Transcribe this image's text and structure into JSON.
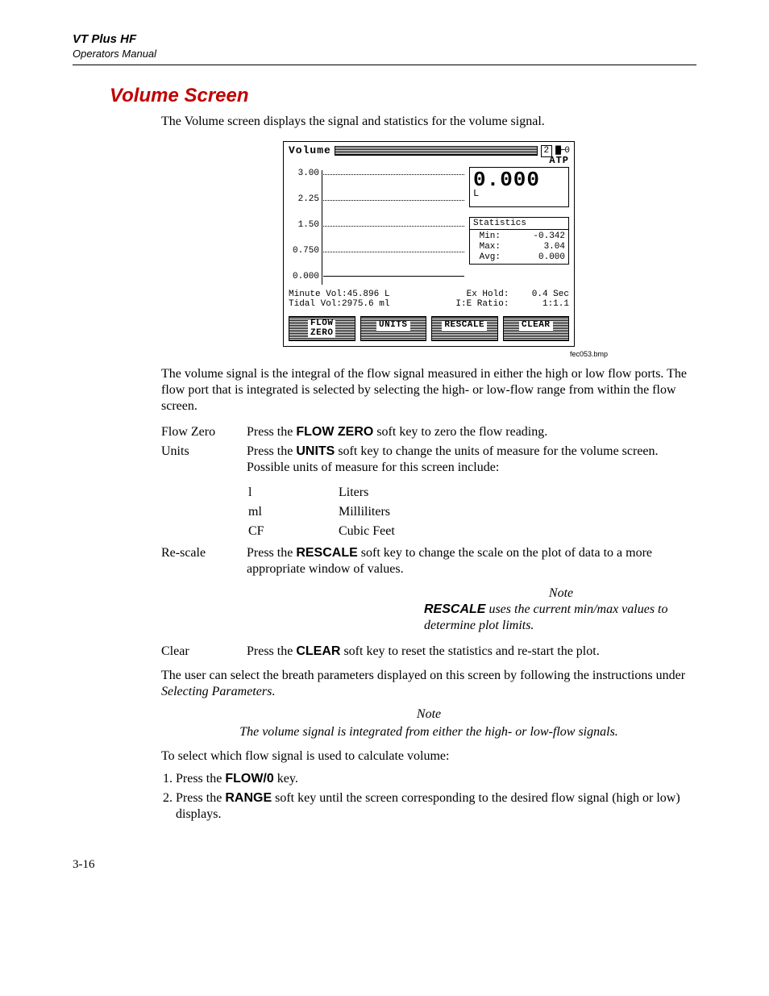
{
  "header": {
    "product": "VT Plus HF",
    "subtitle": "Operators Manual"
  },
  "section": {
    "title": "Volume Screen"
  },
  "intro": "The Volume screen displays the signal and statistics for the volume signal.",
  "figure": {
    "caption": "fec053.bmp",
    "title": "Volume",
    "top_badge": "2",
    "top_icons": "▇⊢0",
    "mode": "ATP",
    "readout": {
      "value": "0.000",
      "unit": "L"
    },
    "y_ticks": [
      "3.00",
      "2.25",
      "1.50",
      "0.750",
      "0.000"
    ],
    "stats": {
      "label": "Statistics",
      "rows": [
        {
          "k": "Min:",
          "v": "-0.342"
        },
        {
          "k": "Max:",
          "v": " 3.04"
        },
        {
          "k": "Avg:",
          "v": " 0.000"
        }
      ]
    },
    "params": {
      "r1c1": "Minute Vol:45.896 L",
      "r1c2": "Ex Hold:",
      "r1c3": "0.4 Sec",
      "r2c1": " Tidal Vol:2975.6 ml",
      "r2c2": "I:E Ratio:",
      "r2c3": "1:1.1"
    },
    "softkeys": [
      "FLOW\nZERO",
      "UNITS",
      "RESCALE",
      "CLEAR"
    ]
  },
  "after_fig": "The volume signal is the integral of the flow signal measured in either the high or low flow ports. The flow port that is integrated is selected by selecting the high- or low-flow range from within the flow screen.",
  "defs": {
    "flowzero": {
      "term": "Flow Zero",
      "pre": "Press the ",
      "key": "FLOW ZERO",
      "post": " soft key to zero the flow reading."
    },
    "units": {
      "term": "Units",
      "pre": "Press the ",
      "key": "UNITS",
      "post": " soft key to change the units of measure for the volume screen. Possible units of measure for this screen include:",
      "table": [
        {
          "sym": "l",
          "name": "Liters"
        },
        {
          "sym": "ml",
          "name": "Milliliters"
        },
        {
          "sym": "CF",
          "name": "Cubic Feet"
        }
      ]
    },
    "rescale": {
      "term": "Re-scale",
      "pre": "Press the ",
      "key": "RESCALE",
      "post": " soft key to change the scale on the plot of data to a more appropriate window of values."
    },
    "clear": {
      "term": "Clear",
      "pre": "Press the ",
      "key": "CLEAR",
      "post": " soft key to reset the statistics and re-start the plot."
    }
  },
  "note1": {
    "label": "Note",
    "key": "RESCALE",
    "body": " uses the current min/max values to determine plot limits."
  },
  "para2a": "The user can select the breath parameters displayed on this screen by following the instructions under ",
  "para2b": "Selecting Parameters",
  "para2c": ".",
  "note2": {
    "label": "Note",
    "body": "The volume signal is integrated from either the high- or low-flow signals."
  },
  "select_intro": "To select which flow signal is used to calculate volume:",
  "steps": {
    "s1_pre": "Press the ",
    "s1_key": "FLOW/0",
    "s1_post": " key.",
    "s2_pre": "Press the ",
    "s2_key": "RANGE",
    "s2_post": " soft key until the screen corresponding to the desired flow signal (high or low) displays."
  },
  "chart_data": {
    "type": "line",
    "title": "Volume",
    "xlabel": "",
    "ylabel": "",
    "ylim": [
      0.0,
      3.0
    ],
    "y_ticks": [
      0.0,
      0.75,
      1.5,
      2.25,
      3.0
    ],
    "series": [
      {
        "name": "volume",
        "x": [
          0,
          1
        ],
        "values": [
          0.0,
          0.0
        ]
      }
    ],
    "annotations": {
      "current": 0.0,
      "unit": "L",
      "min": -0.342,
      "max": 3.04,
      "avg": 0.0,
      "minute_vol_L": 45.896,
      "tidal_vol_ml": 2975.6,
      "ex_hold_sec": 0.4,
      "ie_ratio": "1:1.1"
    }
  },
  "page_number": "3-16"
}
